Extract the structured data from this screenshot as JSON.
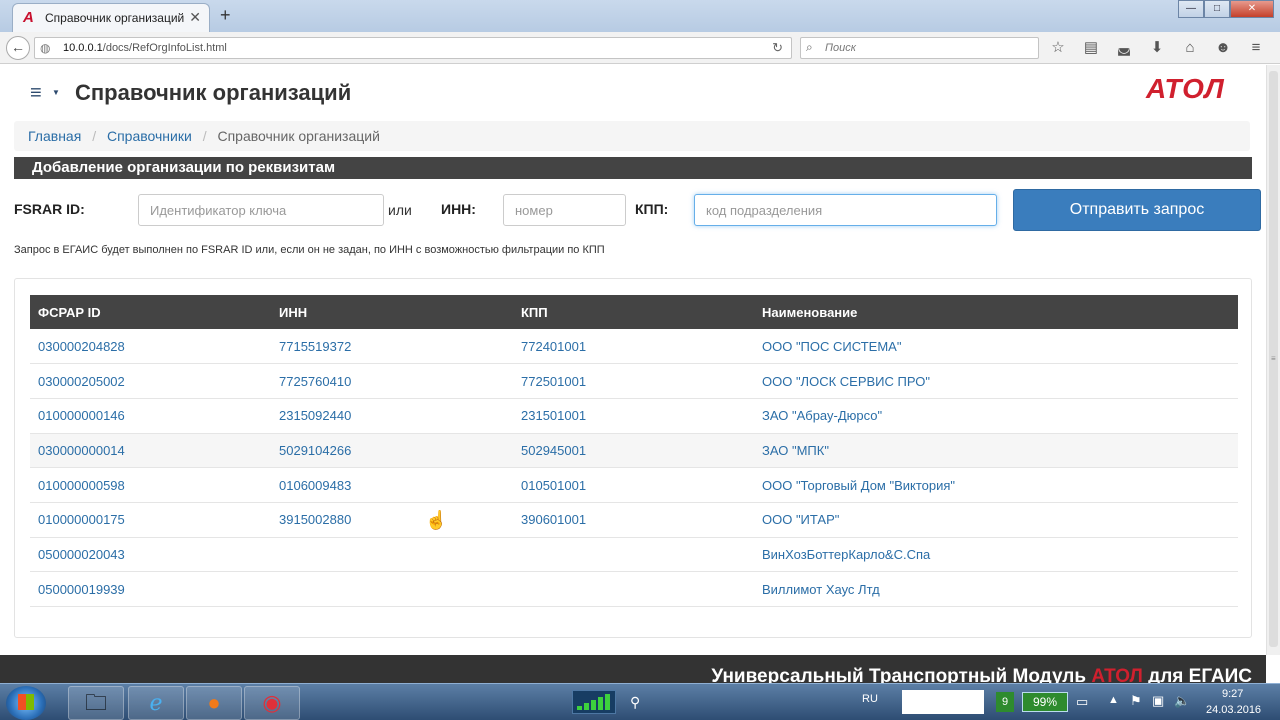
{
  "browser": {
    "tab_title": "Справочник организаций",
    "tab_favicon": "A",
    "new_tab": "+",
    "url_host": "10.0.0.1",
    "url_path": "/docs/RefOrgInfoList.html",
    "search_placeholder": "Поиск",
    "toolbar_icons": [
      "star-icon",
      "bookmarks-list-icon",
      "pocket-icon",
      "download-icon",
      "home-icon",
      "chat-icon",
      "hamburger-menu-icon"
    ]
  },
  "page": {
    "title": "Справочник организаций",
    "logo": "АТОЛ",
    "breadcrumb": {
      "home": "Главная",
      "catalogs": "Справочники",
      "current": "Справочник организаций"
    },
    "section_title": "Добавление организации по реквизитам",
    "form": {
      "fsrar_label": "FSRAR ID:",
      "fsrar_placeholder": "Идентификатор ключа",
      "or_label": "или",
      "inn_label": "ИНН:",
      "inn_placeholder": "номер",
      "kpp_label": "КПП:",
      "kpp_placeholder": "код подразделения",
      "submit": "Отправить запрос"
    },
    "hint": "Запрос в ЕГАИС будет выполнен по FSRAR ID или, если он не задан, по ИНН с возможностью фильтрации по КПП",
    "table": {
      "headers": [
        "ФСРАР ID",
        "ИНН",
        "КПП",
        "Наименование"
      ],
      "rows": [
        [
          "030000204828",
          "7715519372",
          "772401001",
          "ООО \"ПОС СИСТЕМА\""
        ],
        [
          "030000205002",
          "7725760410",
          "772501001",
          "ООО \"ЛОСК СЕРВИС ПРО\""
        ],
        [
          "010000000146",
          "2315092440",
          "231501001",
          "ЗАО \"Абрау-Дюрсо\""
        ],
        [
          "030000000014",
          "5029104266",
          "502945001",
          "ЗАО \"МПК\""
        ],
        [
          "010000000598",
          "0106009483",
          "010501001",
          "ООО \"Торговый Дом \"Виктория\""
        ],
        [
          "010000000175",
          "3915002880",
          "390601001",
          "ООО \"ИТАР\""
        ],
        [
          "050000020043",
          "",
          "",
          "ВинХозБоттерКарло&С.Спа"
        ],
        [
          "050000019939",
          "",
          "",
          "Виллимот Хаус Лтд"
        ]
      ]
    },
    "footer": {
      "text_before": "Универсальный Транспортный Модуль ",
      "brand": "АТОЛ",
      "text_after": " для ЕГАИС"
    }
  },
  "taskbar": {
    "lang": "RU",
    "battery": "99%",
    "battery_tag": "9",
    "time": "9:27",
    "date": "24.03.2016"
  }
}
